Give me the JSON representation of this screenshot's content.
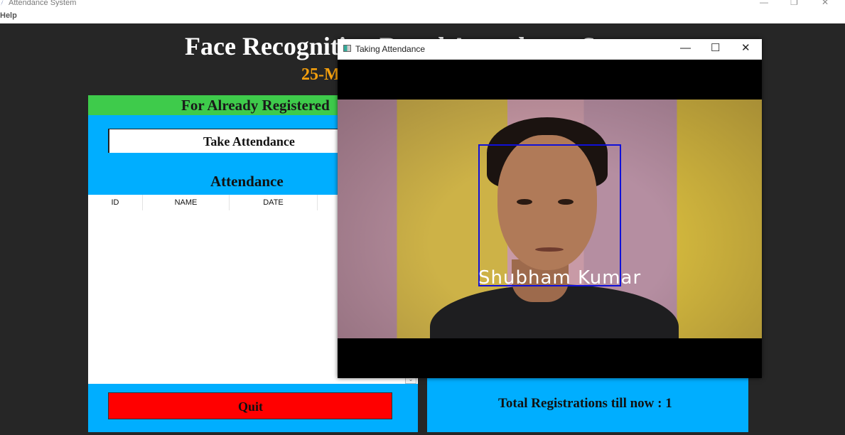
{
  "window": {
    "title": "Attendance System",
    "controls": {
      "minimize": "—",
      "restore": "❐",
      "close": "✕"
    }
  },
  "menu": {
    "help": "Help"
  },
  "header": {
    "title": "Face Recognition Based Attendance System",
    "date": "25-M"
  },
  "left_panel": {
    "heading": "For Already Registered",
    "take_attendance_label": "Take Attendance",
    "attendance_heading": "Attendance",
    "table_columns": [
      "ID",
      "NAME",
      "DATE"
    ],
    "scroll_glyph": "⌄",
    "quit_label": "Quit"
  },
  "right_panel": {
    "total_registrations": "Total Registrations till now  : 1"
  },
  "camera_window": {
    "title": "Taking Attendance",
    "controls": {
      "minimize": "—",
      "maximize": "☐",
      "close": "✕"
    },
    "recognized_name": "Shubham Kumar",
    "box_color": "#1010d8"
  },
  "colors": {
    "background": "#262626",
    "panel_blue": "#00aeff",
    "header_green": "#3ecb4b",
    "quit_red": "#ff0000",
    "date_orange": "#f5a00d"
  }
}
